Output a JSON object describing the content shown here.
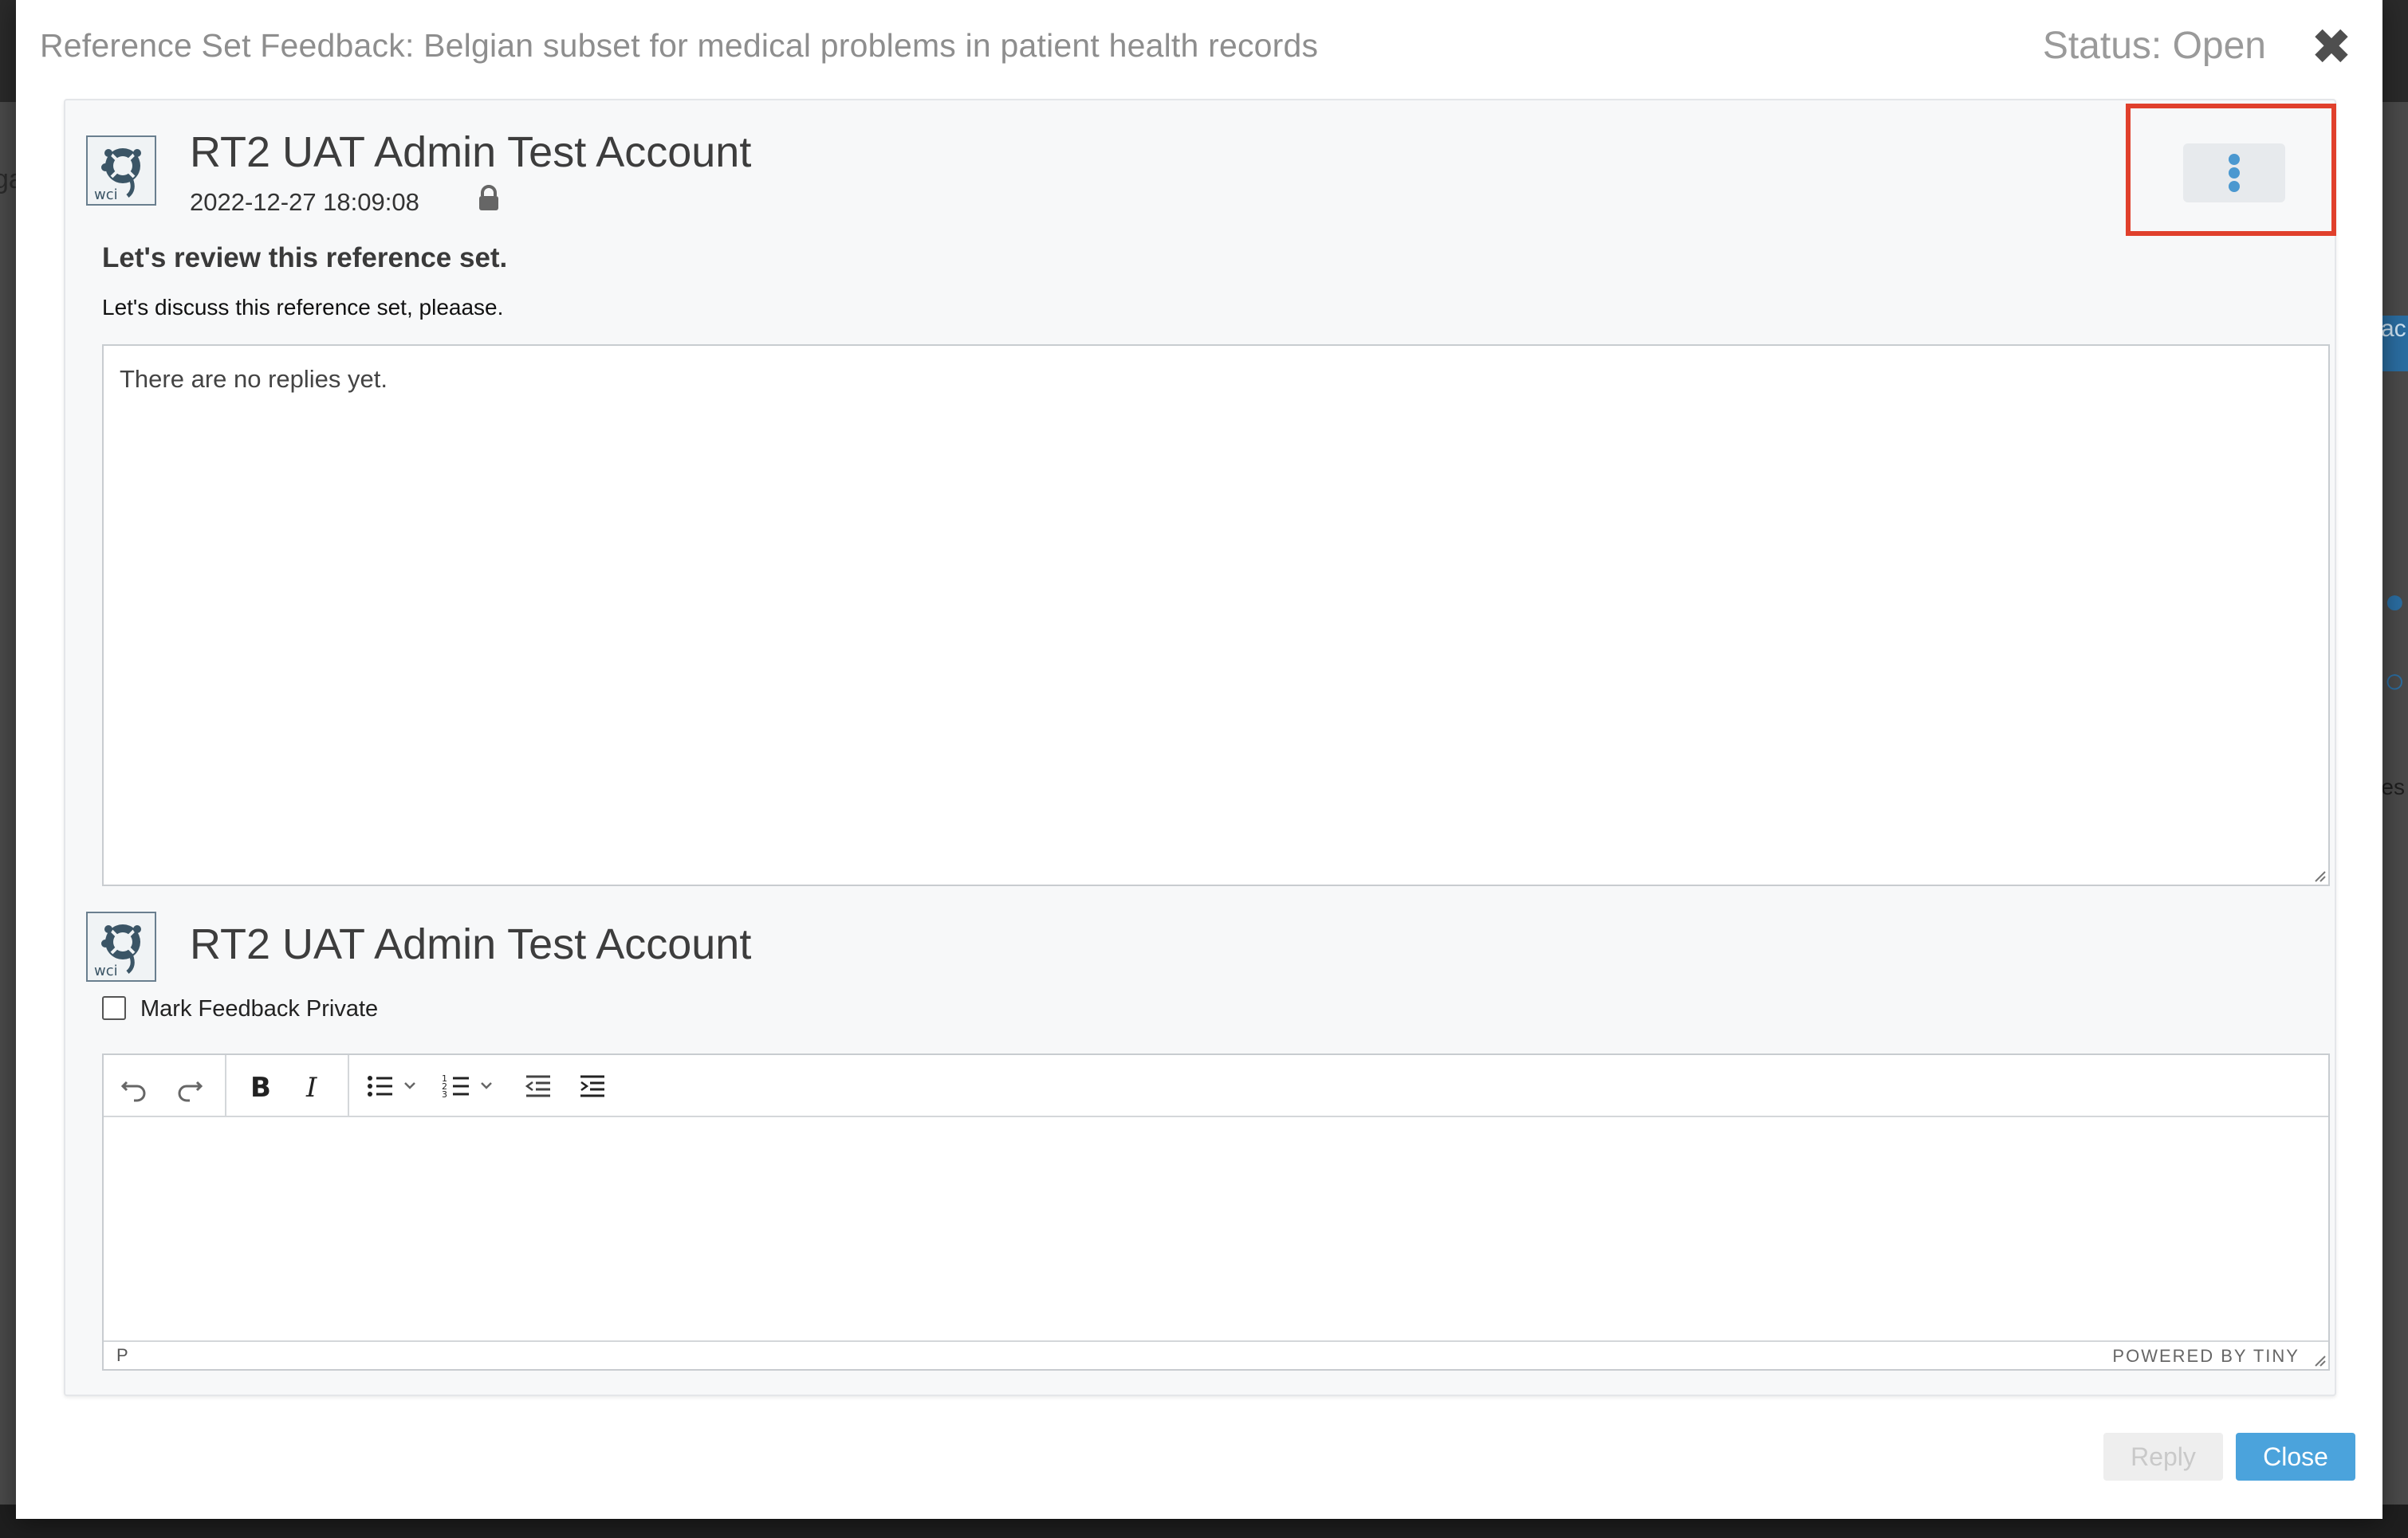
{
  "modal": {
    "title": "Reference Set Feedback: Belgian subset for medical problems in patient health records",
    "status": "Status: Open",
    "close_glyph": "✖"
  },
  "post": {
    "author": "RT2 UAT Admin Test Account",
    "date": "2022-12-27 18:09:08",
    "avatar_label": "wci",
    "subject": "Let's review this reference set.",
    "body": "Let's discuss this reference set, pleaase.",
    "replies_placeholder": "There are no replies yet.",
    "menu_icon": "vertical-ellipsis-icon",
    "lock_icon": "lock-icon"
  },
  "reply": {
    "author": "RT2 UAT Admin Test Account",
    "avatar_label": "wci",
    "private_label": "Mark Feedback Private",
    "private_checked": false,
    "editor": {
      "toolbar": [
        "undo-icon",
        "redo-icon",
        "bold-icon",
        "italic-icon",
        "bullet-list-icon",
        "numbered-list-icon",
        "outdent-icon",
        "indent-icon"
      ],
      "status_path": "P",
      "brand": "POWERED BY TINY"
    }
  },
  "footer": {
    "reply_label": "Reply",
    "close_label": "Close"
  },
  "colors": {
    "accent": "#4ba3dc",
    "highlight": "#e0402c",
    "menu_dots": "#4a98d0"
  },
  "background": {
    "left_fragment": "ga",
    "right_fragment": "es",
    "blue_fragment": "ac"
  }
}
